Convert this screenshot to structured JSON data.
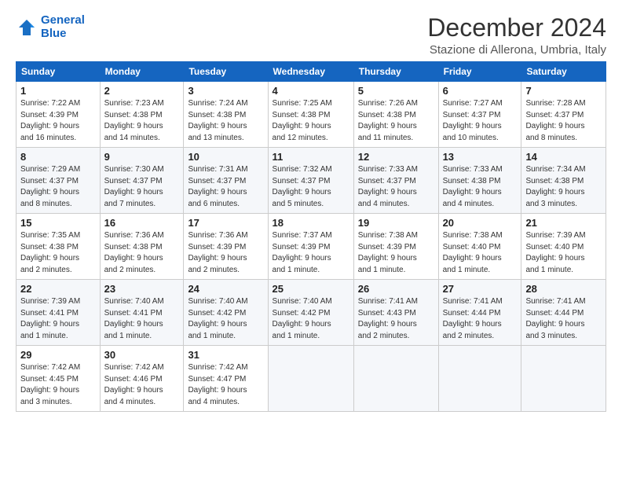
{
  "logo": {
    "line1": "General",
    "line2": "Blue"
  },
  "title": "December 2024",
  "subtitle": "Stazione di Allerona, Umbria, Italy",
  "days_of_week": [
    "Sunday",
    "Monday",
    "Tuesday",
    "Wednesday",
    "Thursday",
    "Friday",
    "Saturday"
  ],
  "weeks": [
    [
      {
        "day": "1",
        "info": "Sunrise: 7:22 AM\nSunset: 4:39 PM\nDaylight: 9 hours\nand 16 minutes."
      },
      {
        "day": "2",
        "info": "Sunrise: 7:23 AM\nSunset: 4:38 PM\nDaylight: 9 hours\nand 14 minutes."
      },
      {
        "day": "3",
        "info": "Sunrise: 7:24 AM\nSunset: 4:38 PM\nDaylight: 9 hours\nand 13 minutes."
      },
      {
        "day": "4",
        "info": "Sunrise: 7:25 AM\nSunset: 4:38 PM\nDaylight: 9 hours\nand 12 minutes."
      },
      {
        "day": "5",
        "info": "Sunrise: 7:26 AM\nSunset: 4:38 PM\nDaylight: 9 hours\nand 11 minutes."
      },
      {
        "day": "6",
        "info": "Sunrise: 7:27 AM\nSunset: 4:37 PM\nDaylight: 9 hours\nand 10 minutes."
      },
      {
        "day": "7",
        "info": "Sunrise: 7:28 AM\nSunset: 4:37 PM\nDaylight: 9 hours\nand 8 minutes."
      }
    ],
    [
      {
        "day": "8",
        "info": "Sunrise: 7:29 AM\nSunset: 4:37 PM\nDaylight: 9 hours\nand 8 minutes."
      },
      {
        "day": "9",
        "info": "Sunrise: 7:30 AM\nSunset: 4:37 PM\nDaylight: 9 hours\nand 7 minutes."
      },
      {
        "day": "10",
        "info": "Sunrise: 7:31 AM\nSunset: 4:37 PM\nDaylight: 9 hours\nand 6 minutes."
      },
      {
        "day": "11",
        "info": "Sunrise: 7:32 AM\nSunset: 4:37 PM\nDaylight: 9 hours\nand 5 minutes."
      },
      {
        "day": "12",
        "info": "Sunrise: 7:33 AM\nSunset: 4:37 PM\nDaylight: 9 hours\nand 4 minutes."
      },
      {
        "day": "13",
        "info": "Sunrise: 7:33 AM\nSunset: 4:38 PM\nDaylight: 9 hours\nand 4 minutes."
      },
      {
        "day": "14",
        "info": "Sunrise: 7:34 AM\nSunset: 4:38 PM\nDaylight: 9 hours\nand 3 minutes."
      }
    ],
    [
      {
        "day": "15",
        "info": "Sunrise: 7:35 AM\nSunset: 4:38 PM\nDaylight: 9 hours\nand 2 minutes."
      },
      {
        "day": "16",
        "info": "Sunrise: 7:36 AM\nSunset: 4:38 PM\nDaylight: 9 hours\nand 2 minutes."
      },
      {
        "day": "17",
        "info": "Sunrise: 7:36 AM\nSunset: 4:39 PM\nDaylight: 9 hours\nand 2 minutes."
      },
      {
        "day": "18",
        "info": "Sunrise: 7:37 AM\nSunset: 4:39 PM\nDaylight: 9 hours\nand 1 minute."
      },
      {
        "day": "19",
        "info": "Sunrise: 7:38 AM\nSunset: 4:39 PM\nDaylight: 9 hours\nand 1 minute."
      },
      {
        "day": "20",
        "info": "Sunrise: 7:38 AM\nSunset: 4:40 PM\nDaylight: 9 hours\nand 1 minute."
      },
      {
        "day": "21",
        "info": "Sunrise: 7:39 AM\nSunset: 4:40 PM\nDaylight: 9 hours\nand 1 minute."
      }
    ],
    [
      {
        "day": "22",
        "info": "Sunrise: 7:39 AM\nSunset: 4:41 PM\nDaylight: 9 hours\nand 1 minute."
      },
      {
        "day": "23",
        "info": "Sunrise: 7:40 AM\nSunset: 4:41 PM\nDaylight: 9 hours\nand 1 minute."
      },
      {
        "day": "24",
        "info": "Sunrise: 7:40 AM\nSunset: 4:42 PM\nDaylight: 9 hours\nand 1 minute."
      },
      {
        "day": "25",
        "info": "Sunrise: 7:40 AM\nSunset: 4:42 PM\nDaylight: 9 hours\nand 1 minute."
      },
      {
        "day": "26",
        "info": "Sunrise: 7:41 AM\nSunset: 4:43 PM\nDaylight: 9 hours\nand 2 minutes."
      },
      {
        "day": "27",
        "info": "Sunrise: 7:41 AM\nSunset: 4:44 PM\nDaylight: 9 hours\nand 2 minutes."
      },
      {
        "day": "28",
        "info": "Sunrise: 7:41 AM\nSunset: 4:44 PM\nDaylight: 9 hours\nand 3 minutes."
      }
    ],
    [
      {
        "day": "29",
        "info": "Sunrise: 7:42 AM\nSunset: 4:45 PM\nDaylight: 9 hours\nand 3 minutes."
      },
      {
        "day": "30",
        "info": "Sunrise: 7:42 AM\nSunset: 4:46 PM\nDaylight: 9 hours\nand 4 minutes."
      },
      {
        "day": "31",
        "info": "Sunrise: 7:42 AM\nSunset: 4:47 PM\nDaylight: 9 hours\nand 4 minutes."
      },
      null,
      null,
      null,
      null
    ]
  ]
}
